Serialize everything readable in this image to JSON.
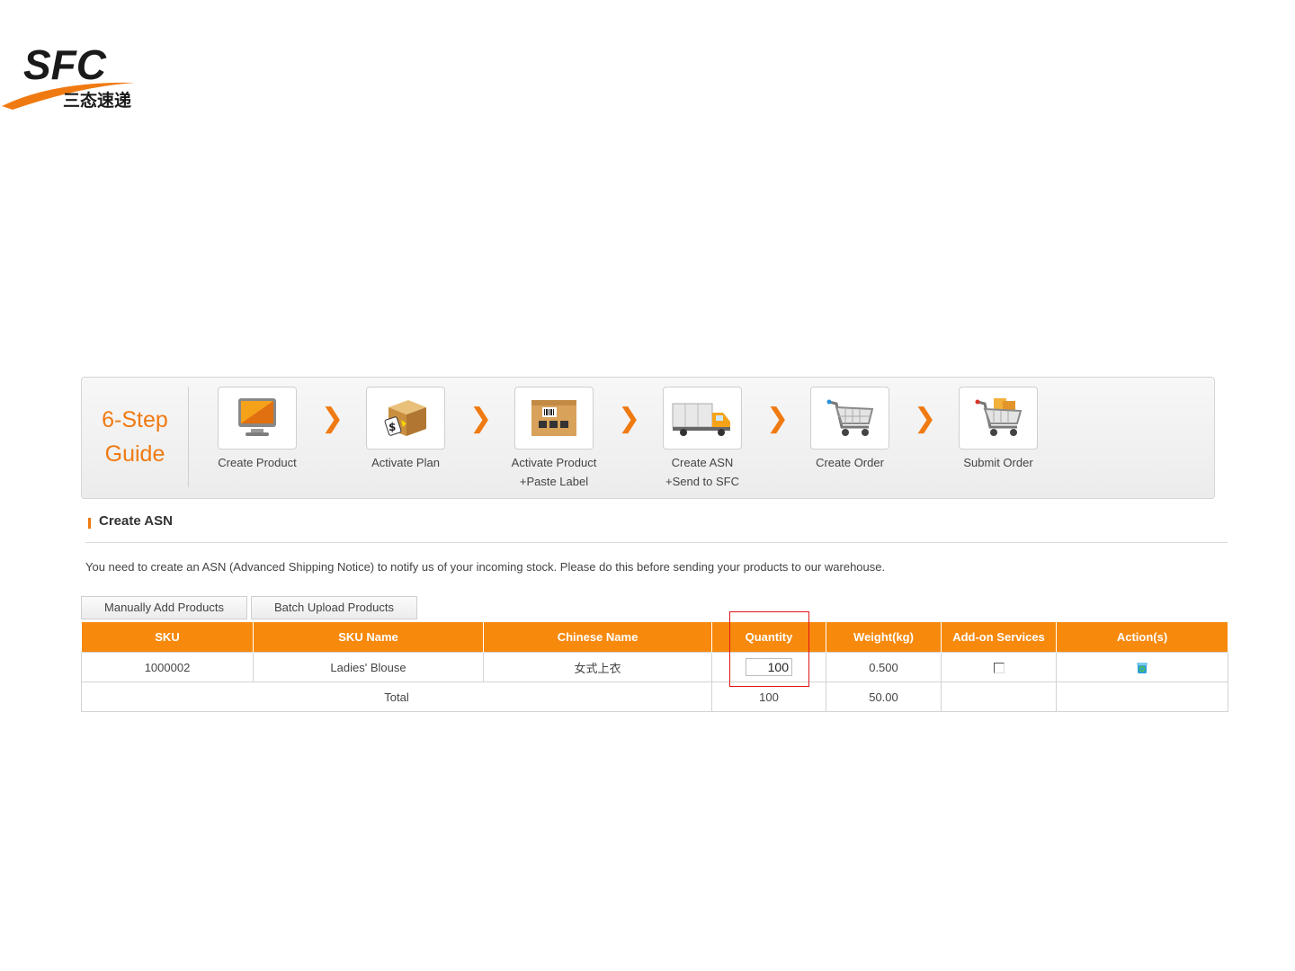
{
  "brand": {
    "logo_text": "SFC",
    "logo_sub": "三态速递",
    "accent": "#f07a12"
  },
  "guide": {
    "title_line1": "6-Step",
    "title_line2": "Guide",
    "steps": [
      {
        "line1": "Create Product",
        "line2": "",
        "icon": "monitor-icon"
      },
      {
        "line1": "Activate Plan",
        "line2": "",
        "icon": "box-price-icon"
      },
      {
        "line1": "Activate Product",
        "line2": "+Paste Label",
        "icon": "labeled-box-icon"
      },
      {
        "line1": "Create ASN",
        "line2": "+Send to SFC",
        "icon": "truck-icon"
      },
      {
        "line1": "Create Order",
        "line2": "",
        "icon": "cart-icon"
      },
      {
        "line1": "Submit Order",
        "line2": "",
        "icon": "cart-full-icon"
      }
    ],
    "arrow": "❯"
  },
  "section": {
    "title": "Create ASN",
    "description": "You need to create an ASN (Advanced Shipping Notice) to notify us of your incoming stock. Please do this before sending your products to our warehouse."
  },
  "tabs": {
    "manual": "Manually Add Products",
    "batch": "Batch Upload Products"
  },
  "table": {
    "headers": {
      "sku": "SKU",
      "sku_name": "SKU Name",
      "chinese_name": "Chinese Name",
      "quantity": "Quantity",
      "weight": "Weight(kg)",
      "addon": "Add-on Services",
      "actions": "Action(s)"
    },
    "rows": [
      {
        "sku": "1000002",
        "sku_name": "Ladies' Blouse",
        "chinese_name": "女式上衣",
        "quantity": "100",
        "weight": "0.500",
        "addon_checked": false
      }
    ],
    "total": {
      "label": "Total",
      "quantity": "100",
      "weight": "50.00"
    },
    "header_color": "#f7890d"
  }
}
